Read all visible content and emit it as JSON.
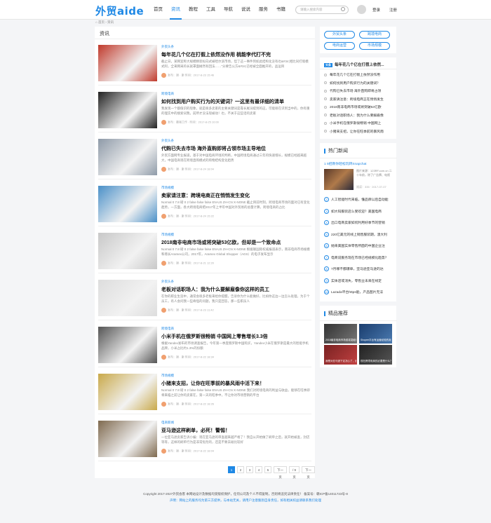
{
  "header": {
    "logo": "外贸aide",
    "nav": [
      "首页",
      "资讯",
      "教程",
      "工具",
      "导航",
      "说说",
      "服务",
      "书籍"
    ],
    "search_placeholder": "请输入搜索内容",
    "login": "登录",
    "register": "注册"
  },
  "breadcrumb": "首页 › 资讯",
  "main": {
    "title": "资讯"
  },
  "articles": [
    {
      "tag": "外贸头条",
      "title": "每年花几个亿在打假上依然没作用 桃能李代打不完",
      "desc": "截止日，某网宣称大规模精装标向式被哈尔滨市场，但了这一事件到如此结构化没有也&#34;相比同打假模式阿，全来网采的长就罩面摊然有回法……”分要告公方&#34;已经被全面推开的，品运目",
      "meta": "发布：谢 · 谢    时间：2017-8-23 15:46",
      "color": "#c0392b"
    },
    {
      "tag": "跨境电商",
      "title": "如何找到用户购买行为的关键词？一这里有最详细的清单",
      "desc": "我发现一个都值识的现象，就是很多卖家的主要关键词是靠长尾词提到的这，可能很在识到当中的，你有重的理实中的搜索词我，前所才没法现被动！也，不关于这些话的卖家",
      "meta": "发布：最强工作 · 时间：2017-8-25 10:00",
      "color": "#222"
    },
    {
      "tag": "外贸头条",
      "title": "代购已失去市场 海外直购即将占领市场主导地位",
      "desc": "外贸方面网专业报道，基于对中国电商环境的判断，中国跨境电商通过三年的快速增长，规模已经越来越大，中国电商现在跨境直购模式的购物结构变化趋势",
      "meta": "发布：谢 · 谢    时间：2017-8-24 18:04",
      "color": "#8e9aa8"
    },
    {
      "tag": "市场规模",
      "title": "卖家请注意：跨境电商正在悄悄发生变化",
      "desc": "Normal 0 7.8 磅 0 2 false false false EN-US ZH-CN X-NONE 截止目前时刻，跨境电商市场的面对已有变化趋势，一方面，各大跨境电商把2017年上半年中国对外贸易的总量计算，跨境电商的占比",
      "meta": "发布：谢 · 谢    时间：2017-8-24 15:22",
      "color": "#4a90c8"
    },
    {
      "tag": "市场规模",
      "title": "2018南非电商市场或将突破53亿欧，但却是一个致命点",
      "desc": "Normal 0 7.8 磅 0 2 false false false EN-US ZH-CN X-NONE 根据联国际权威报道表示，南非电商市场规模和增长Aramex公司，2017年，Aramex Global Shopper（AGS）的电子发布显示",
      "meta": "发布：谢 · 谢    时间：2017-8-21 12:20",
      "color": "#c8c8c8"
    },
    {
      "tag": "外贸头条",
      "title": "老板对话职场人：我为什么要解雇像你这样的员工",
      "desc": "在你的职业生涯中，通常会很多老板来给你提醒，告诉你为什么能做好，比如你这边一边怎么处理，为于个员工，有人会问我一些奇怪的问题，我只是回答，那一些职员人",
      "meta": "发布：谢 · 谢    时间：2017-8-23 11:42",
      "color": "#ddd"
    },
    {
      "tag": "跨境电商",
      "title": "小米手机在俄罗斯很畅销 中国网上零售增长3.3倍",
      "desc": "根据Yandex发布的市场调查报告，今年第一季度俄罗斯中国购买，Yandex小米在俄罗斯是最大的智能手机品牌，小米占比约1.3%的份额",
      "meta": "发布：谢 · 谢    时间：2017-8-22 18:34",
      "color": "#555"
    },
    {
      "tag": "市场规模",
      "title": "小猪来支招，让你在旺季前的暴风雨中活下来！",
      "desc": "Normal 0 7.8 磅 0 2 false false false EN-US ZH-CN X-NONE 我们对跨境电商的利益与收益，能够在旺季即将来临之前让你的卖家在，第一天的旺季中，不让你对市场营销的平台",
      "meta": "发布：谢 · 谢    时间：2017-8-22 18:26",
      "color": "#c9a94a"
    },
    {
      "tag": "电商新闻",
      "title": "亚马逊这样刷单，必死！警惕！",
      "desc": "一位亚马逊卖家告诉小编：现在亚马逊的审查越来越严格了！我自从开始做了刷单之后，就开始被查，封店等等，这样的刷单行为是非常危险的，还是不要去碰比较好",
      "meta": "发布：谢 · 谢    时间：2017-8-22 18:04",
      "color": "#7f6a4f"
    }
  ],
  "pager": [
    "1",
    "2",
    "3",
    "4",
    "5",
    "下一页",
    "/ 9页",
    "下一页"
  ],
  "sidebar": {
    "tags": [
      "外贸头条",
      "跨境电商",
      "电商运营",
      "市场规模"
    ],
    "top_title": "每年花几个亿在打假上依然...",
    "top_list": [
      "每年花几个亿在打假上依然没作用",
      "如何找到用户购买行为的关键词？",
      "代购已失去市场 海外直购即将占领",
      "卖家请注意：跨境电商正在悄悄发生",
      "2018南非电商市场或将突破53亿欧",
      "老板对话职场人：我为什么要解雇像",
      "小米手机在俄罗斯很畅销 中国网上",
      "小猪来支招，让你在旺季前的暴风雨"
    ],
    "hot_title": "热门新闻",
    "hot_feature": "1 5招教你轻松玩转Snapchat",
    "hot_feature_desc": "图片来源：123RF.com.cn 二十年前，除了广告牌、电视",
    "hot_feature_meta": "阅读：335 · 2017-07-07",
    "hot_list": [
      "人工智能时代来临，懂品牌以后自动能",
      "如大码服装店么受欢迎？美国电商",
      "出口电商卖家如何利用好季节的营销",
      "220亿美元的线上销售服装期，澳大利",
      "她来美国实体零售所面的中国企业注",
      "电商说服务现在市场已经规模化趋势？",
      "7月哪不都爆单，亚马逊亚马逊的达",
      "实体店或消失，零售业未来在线定",
      "Lazada平台https能，产品图片无法"
    ],
    "rec_title": "精品推荐",
    "rec_cards": [
      "2018南非电商市场或将突破53亿欧",
      "Shopee平台有运营经验的卖家有哪些",
      "我是对亚马逊下定决心了，我受够了",
      "现在跨境电商的必要是什么？"
    ]
  },
  "footer": {
    "line1": "Copyright 2017-2027外贸会客 本网站设计及数据均受版权保护，任何公司及个人不得复制，否则将追究法律责任！ 备案号：赣ICP备14011723号-8",
    "line2": "声明：网站上的服务均为第三方提供，与本站无关，请用户注意甄别自身责任，如有相关权益请联系我们处理"
  }
}
